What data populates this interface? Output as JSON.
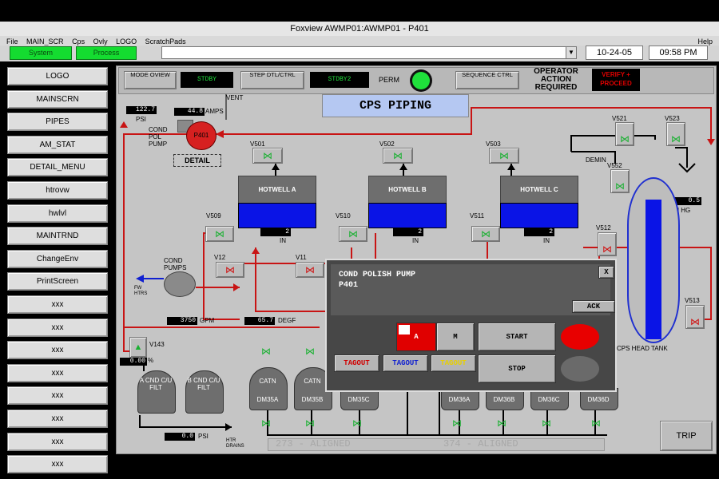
{
  "window": {
    "title": "Foxview AWMP01:AWMP01 - P401"
  },
  "menu": {
    "items": [
      "File",
      "MAIN_SCR",
      "Cps",
      "Ovly",
      "LOGO",
      "ScratchPads"
    ],
    "help": "Help"
  },
  "toolbar": {
    "system_label": "System",
    "process_label": "Process",
    "date": "10-24-05",
    "time": "09:58 PM"
  },
  "sidebar": {
    "items": [
      "LOGO",
      "MAINSCRN",
      "PIPES",
      "AM_STAT",
      "DETAIL_MENU",
      "htrovw",
      "hwlvl",
      "MAINTRND",
      "ChangeEnv",
      "PrintScreen",
      "xxx",
      "xxx",
      "xxx",
      "xxx",
      "xxx",
      "xxx",
      "xxx",
      "xxx"
    ]
  },
  "header": {
    "mode_label": "MODE OVIEW",
    "stdby1": "STDBY",
    "step_label": "STEP DTL/CTRL",
    "stdby2": "STDBY2",
    "perm": "PERM",
    "sequence_label": "SEQUENCE CTRL",
    "operator_action": "OPERATOR ACTION REQUIRED",
    "verify": "VERIFY + PROCEED"
  },
  "diagram": {
    "title": "CPS PIPING",
    "psi_top": "122.7",
    "psi_top_unit": "PSI",
    "amps": "44.8",
    "amps_unit": "AMPS",
    "vent": "VENT",
    "cond_pol_pump": "COND POL PUMP",
    "pump_name": "P401",
    "detail": "DETAIL",
    "hotwells": [
      {
        "name": "HOTWELL A",
        "value": "2",
        "unit": "IN"
      },
      {
        "name": "HOTWELL B",
        "value": "2",
        "unit": "IN"
      },
      {
        "name": "HOTWELL C",
        "value": "2",
        "unit": "IN"
      }
    ],
    "valves": {
      "v501": "V501",
      "v502": "V502",
      "v503": "V503",
      "v509": "V509",
      "v510": "V510",
      "v511": "V511",
      "v512": "V512",
      "v513": "V513",
      "v521": "V521",
      "v523": "V523",
      "v552": "V552",
      "v12": "V12",
      "v11": "V11",
      "v143": "V143"
    },
    "demin": "DEMIN",
    "in_hg_value": "0.5",
    "in_hg_unit": "IN HG",
    "cond_pumps": "COND PUMPS",
    "fw_htrs": "FW HTRS",
    "gpm_value": "3750",
    "gpm_unit": "GPM",
    "degf_value": "65.7",
    "degf_unit": "DEGF",
    "small_value": "0.00",
    "small_unit": "%",
    "filters": [
      {
        "name": "A CND C/U FILT"
      },
      {
        "name": "B CND C/U FILT"
      }
    ],
    "psi_bottom": "0.0",
    "psi_bottom_unit": "PSI",
    "htr_drains": "HTR DRAINS",
    "catn1": "CATN",
    "catn2": "CATN",
    "demins": [
      "DM35A",
      "DM35B",
      "DM35C",
      "DM36A",
      "DM36B",
      "DM36C",
      "DM36D"
    ],
    "aligned1": "273 - ALIGNED",
    "aligned2": "374 - ALIGNED",
    "head_tank": "CPS HEAD TANK",
    "trip": "TRIP"
  },
  "popup": {
    "title": "COND POLISH PUMP",
    "subtitle": "P401",
    "close": "X",
    "ack": "ACK",
    "auto": "A",
    "manual": "M",
    "start": "START",
    "stop": "STOP",
    "tagout1": "TAGOUT",
    "tagout2": "TAGOUT",
    "tagout3": "TAGOUT"
  },
  "colors": {
    "pipe_red": "#c81414",
    "water_blue": "#0a14e6",
    "run_green": "#1fe03b",
    "alarm_red": "#e00000"
  }
}
